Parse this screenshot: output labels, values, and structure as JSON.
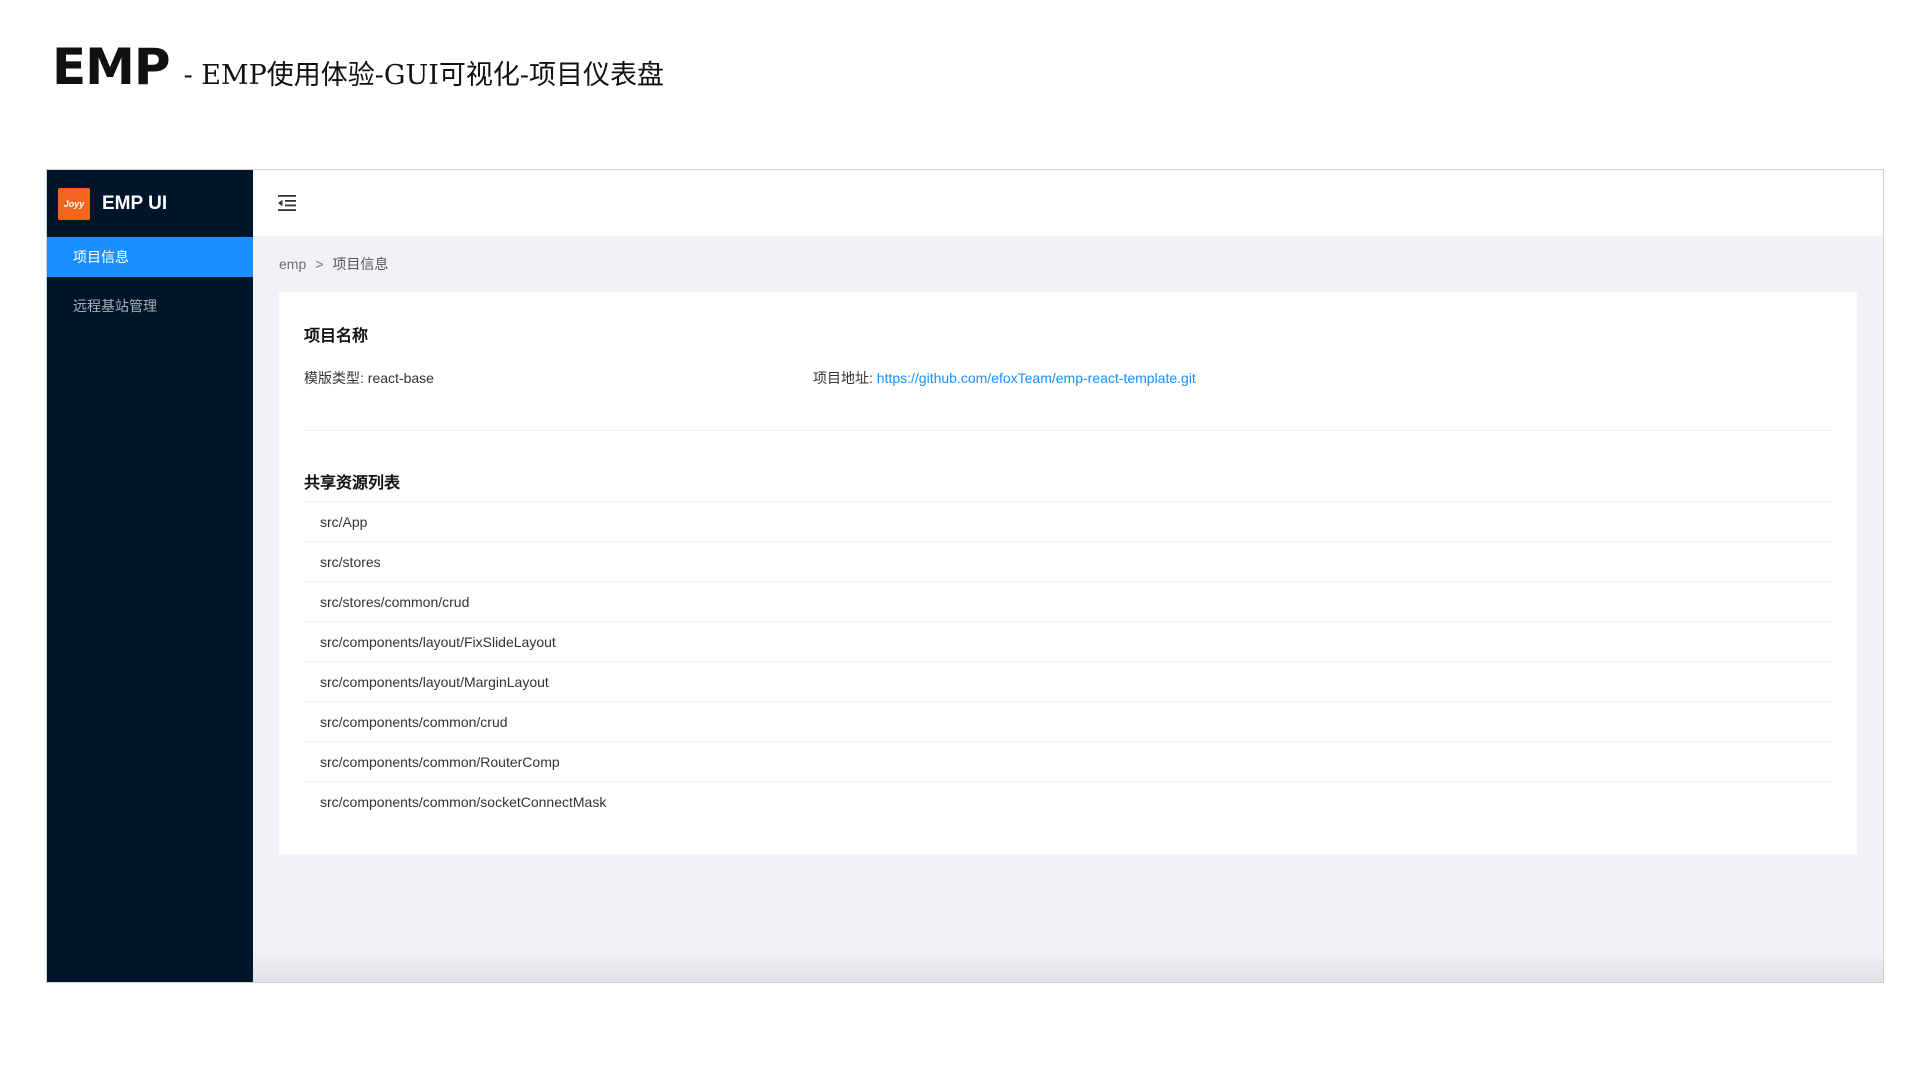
{
  "slide": {
    "title_big": "EMP",
    "title_sub": "- EMP使用体验-GUI可视化-项目仪表盘"
  },
  "app": {
    "brand": "EMP UI",
    "logo_text": "Joyy"
  },
  "sidebar": {
    "items": [
      {
        "label": "项目信息",
        "active": true
      },
      {
        "label": "远程基站管理",
        "active": false
      }
    ]
  },
  "header": {
    "fold_icon": "menu-fold-icon"
  },
  "breadcrumb": {
    "root": "emp",
    "separator": ">",
    "current": "项目信息"
  },
  "project": {
    "title": "项目名称",
    "template_label": "模版类型:",
    "template_value": "react-base",
    "address_label": "项目地址:",
    "address_value": "https://github.com/efoxTeam/emp-react-template.git"
  },
  "shared": {
    "title": "共享资源列表",
    "items": [
      "src/App",
      "src/stores",
      "src/stores/common/crud",
      "src/components/layout/FixSlideLayout",
      "src/components/layout/MarginLayout",
      "src/components/common/crud",
      "src/components/common/RouterComp",
      "src/components/common/socketConnectMask"
    ]
  },
  "colors": {
    "sidebar_bg": "#001529",
    "accent": "#1890ff",
    "logo_bg": "#f5641e"
  }
}
